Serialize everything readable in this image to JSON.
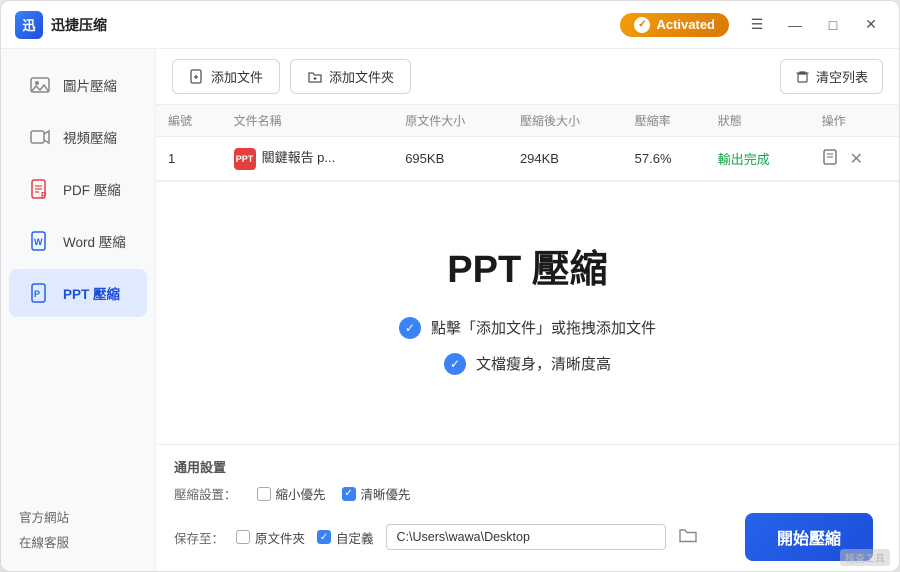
{
  "titlebar": {
    "appname": "迅捷压缩",
    "activated_label": "Activated",
    "btn_menu": "☰",
    "btn_min": "—",
    "btn_max": "□",
    "btn_close": "✕"
  },
  "sidebar": {
    "items": [
      {
        "id": "image",
        "label": "圖片壓縮",
        "icon": "image"
      },
      {
        "id": "video",
        "label": "視頻壓縮",
        "icon": "video"
      },
      {
        "id": "pdf",
        "label": "PDF 壓縮",
        "icon": "pdf"
      },
      {
        "id": "word",
        "label": "Word 壓縮",
        "icon": "word"
      },
      {
        "id": "ppt",
        "label": "PPT 壓縮",
        "icon": "ppt",
        "active": true
      }
    ],
    "links": [
      {
        "id": "official",
        "label": "官方網站"
      },
      {
        "id": "support",
        "label": "在線客服"
      }
    ]
  },
  "toolbar": {
    "add_file_label": "添加文件",
    "add_folder_label": "添加文件夾",
    "clear_label": "清空列表"
  },
  "table": {
    "headers": [
      "編號",
      "文件名稱",
      "原文件大小",
      "壓縮後大小",
      "壓縮率",
      "狀態",
      "操作"
    ],
    "rows": [
      {
        "index": "1",
        "filename": "關鍵報告 p...",
        "original_size": "695KB",
        "compressed_size": "294KB",
        "ratio": "57.6%",
        "status": "輸出完成",
        "file_type": "PPT"
      }
    ]
  },
  "promo": {
    "title": "PPT 壓縮",
    "features": [
      "點擊「添加文件」或拖拽添加文件",
      "文檔瘦身，清晰度高"
    ]
  },
  "settings": {
    "section_label": "通用設置",
    "compress_label": "壓縮設置：",
    "option1_label": "縮小優先",
    "option1_checked": false,
    "option2_label": "清晰優先",
    "option2_checked": true,
    "save_label": "保存至：",
    "original_folder_label": "原文件夾",
    "original_folder_checked": false,
    "custom_label": "自定義",
    "custom_checked": true,
    "save_path": "C:\\Users\\wawa\\Desktop",
    "start_label": "開始壓縮"
  },
  "watermark": "稽查工具"
}
